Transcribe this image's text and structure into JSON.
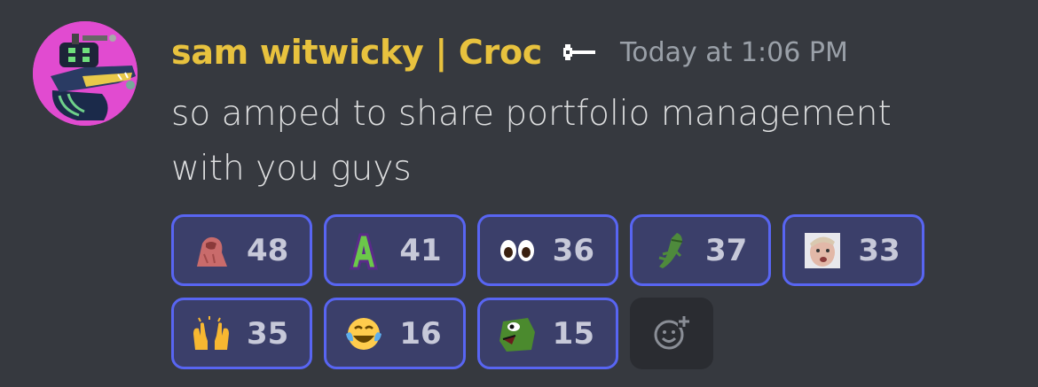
{
  "message": {
    "author": "sam witwicky | Croc",
    "author_color": "#e8c23e",
    "badge_icon": "mod-badge-icon",
    "timestamp": "Today at 1:06 PM",
    "content": "so amped to share portfolio management with you guys"
  },
  "reactions": [
    {
      "emoji": "pink-blob-emoji",
      "count": "48"
    },
    {
      "emoji": "green-letter-a-emoji",
      "count": "41"
    },
    {
      "emoji": "eyes-emoji",
      "count": "36"
    },
    {
      "emoji": "crocodile-emoji",
      "count": "37"
    },
    {
      "emoji": "face-meme-emoji",
      "count": "33"
    },
    {
      "emoji": "raised-hands-emoji",
      "count": "35"
    },
    {
      "emoji": "joy-emoji",
      "count": "16"
    },
    {
      "emoji": "pepe-frog-emoji",
      "count": "15"
    }
  ],
  "add_reaction": {
    "icon": "add-reaction-icon"
  },
  "colors": {
    "background": "#36393f",
    "reaction_border": "#5865f2",
    "reaction_fill": "#3b3f6a",
    "avatar_bg": "#e14bd0"
  }
}
